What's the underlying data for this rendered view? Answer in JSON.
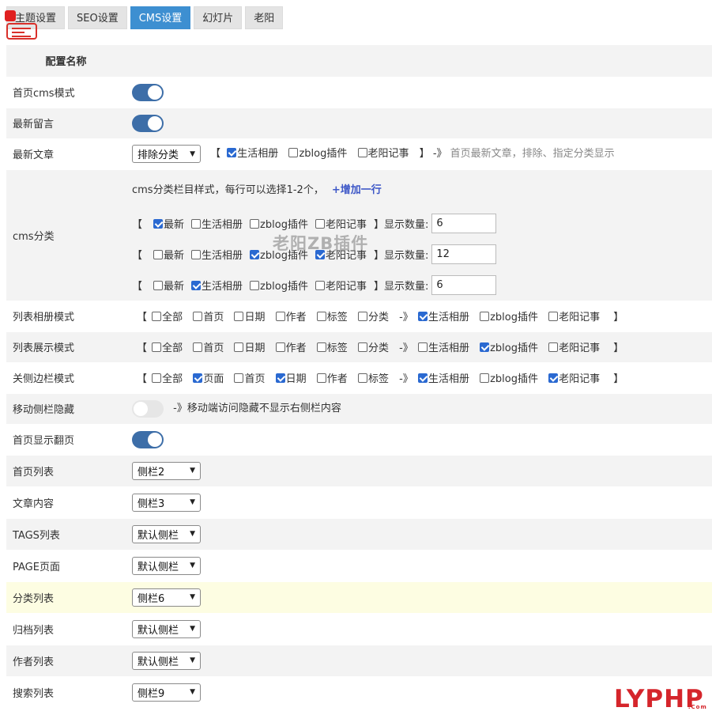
{
  "tabs": [
    "主题设置",
    "SEO设置",
    "CMS设置",
    "幻灯片",
    "老阳"
  ],
  "active_tab": "CMS设置",
  "header": {
    "name": "配置名称"
  },
  "rows": {
    "home_cms": {
      "label": "首页cms模式",
      "on": true
    },
    "latest_comments": {
      "label": "最新留言",
      "on": true
    },
    "latest_articles": {
      "label": "最新文章",
      "select": "排除分类",
      "options": [
        {
          "text": "生活相册",
          "checked": true
        },
        {
          "text": "zblog插件",
          "checked": false
        },
        {
          "text": "老阳记事",
          "checked": false
        }
      ],
      "open": "【",
      "close": "】",
      "arrow": "-》",
      "note": "首页最新文章，排除、指定分类显示"
    },
    "cms_category": {
      "label": "cms分类",
      "intro": "cms分类栏目样式，每行可以选择1-2个，",
      "add": "+增加一行",
      "count_label": "】显示数量:",
      "lines": [
        {
          "options": [
            {
              "text": "最新",
              "checked": true
            },
            {
              "text": "生活相册",
              "checked": false
            },
            {
              "text": "zblog插件",
              "checked": false
            },
            {
              "text": "老阳记事",
              "checked": false
            }
          ],
          "count": "6"
        },
        {
          "options": [
            {
              "text": "最新",
              "checked": false
            },
            {
              "text": "生活相册",
              "checked": false
            },
            {
              "text": "zblog插件",
              "checked": true
            },
            {
              "text": "老阳记事",
              "checked": true
            }
          ],
          "count": "12"
        },
        {
          "options": [
            {
              "text": "最新",
              "checked": false
            },
            {
              "text": "生活相册",
              "checked": true
            },
            {
              "text": "zblog插件",
              "checked": false
            },
            {
              "text": "老阳记事",
              "checked": false
            }
          ],
          "count": "6"
        }
      ]
    },
    "list_album": {
      "label": "列表相册模式",
      "options": [
        {
          "text": "全部",
          "checked": false
        },
        {
          "text": "首页",
          "checked": false
        },
        {
          "text": "日期",
          "checked": false
        },
        {
          "text": "作者",
          "checked": false
        },
        {
          "text": "标签",
          "checked": false
        },
        {
          "text": "分类",
          "checked": false
        }
      ],
      "cats": [
        {
          "text": "生活相册",
          "checked": true
        },
        {
          "text": "zblog插件",
          "checked": false
        },
        {
          "text": "老阳记事",
          "checked": false
        }
      ]
    },
    "list_display": {
      "label": "列表展示模式",
      "options": [
        {
          "text": "全部",
          "checked": false
        },
        {
          "text": "首页",
          "checked": false
        },
        {
          "text": "日期",
          "checked": false
        },
        {
          "text": "作者",
          "checked": false
        },
        {
          "text": "标签",
          "checked": false
        },
        {
          "text": "分类",
          "checked": false
        }
      ],
      "cats": [
        {
          "text": "生活相册",
          "checked": false
        },
        {
          "text": "zblog插件",
          "checked": true
        },
        {
          "text": "老阳记事",
          "checked": false
        }
      ]
    },
    "close_sidebar": {
      "label": "关侧边栏模式",
      "options": [
        {
          "text": "全部",
          "checked": false
        },
        {
          "text": "页面",
          "checked": true
        },
        {
          "text": "首页",
          "checked": false
        },
        {
          "text": "日期",
          "checked": true
        },
        {
          "text": "作者",
          "checked": false
        },
        {
          "text": "标签",
          "checked": false
        }
      ],
      "cats": [
        {
          "text": "生活相册",
          "checked": true
        },
        {
          "text": "zblog插件",
          "checked": false
        },
        {
          "text": "老阳记事",
          "checked": true
        }
      ]
    },
    "mobile_hide": {
      "label": "移动侧栏隐藏",
      "on": false,
      "note": "-》移动端访问隐藏不显示右侧栏内容"
    },
    "home_paging": {
      "label": "首页显示翻页",
      "on": true
    },
    "home_list": {
      "label": "首页列表",
      "value": "侧栏2"
    },
    "article": {
      "label": "文章内容",
      "value": "侧栏3"
    },
    "tags_list": {
      "label": "TAGS列表",
      "value": "默认侧栏"
    },
    "page": {
      "label": "PAGE页面",
      "value": "默认侧栏"
    },
    "cat_list": {
      "label": "分类列表",
      "value": "侧栏6"
    },
    "archive_list": {
      "label": "归档列表",
      "value": "默认侧栏"
    },
    "author_list": {
      "label": "作者列表",
      "value": "默认侧栏"
    },
    "search_list": {
      "label": "搜索列表",
      "value": "侧栏9"
    }
  },
  "watermark": "老阳ZB插件",
  "logo": "LYPHP",
  "logo_sub": ".Com",
  "colors": {
    "accent": "#3d8fd1",
    "toggle_on": "#3d6ea8",
    "checkbox": "#2a69d1",
    "logo": "#d5252b",
    "highlight_row": "#fdfde2"
  }
}
